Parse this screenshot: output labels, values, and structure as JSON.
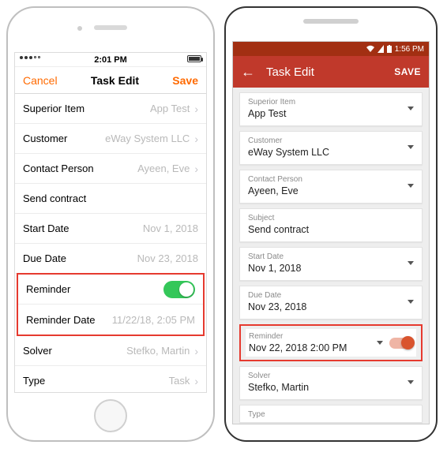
{
  "ios": {
    "statusTime": "2:01 PM",
    "nav": {
      "cancel": "Cancel",
      "title": "Task Edit",
      "save": "Save"
    },
    "rows": {
      "superior": {
        "label": "Superior Item",
        "value": "App Test"
      },
      "customer": {
        "label": "Customer",
        "value": "eWay System LLC"
      },
      "contact": {
        "label": "Contact Person",
        "value": "Ayeen,  Eve"
      },
      "subject": {
        "label": "Send contract"
      },
      "start": {
        "label": "Start Date",
        "value": "Nov 1, 2018"
      },
      "due": {
        "label": "Due Date",
        "value": "Nov 23, 2018"
      },
      "reminder": {
        "label": "Reminder"
      },
      "remdate": {
        "label": "Reminder Date",
        "value": "11/22/18, 2:05 PM"
      },
      "solver": {
        "label": "Solver",
        "value": "Stefko, Martin"
      },
      "type": {
        "label": "Type",
        "value": "Task"
      }
    }
  },
  "android": {
    "statusTime": "1:56 PM",
    "appbar": {
      "title": "Task Edit",
      "save": "SAVE"
    },
    "cards": {
      "superior": {
        "label": "Superior Item",
        "value": "App Test"
      },
      "customer": {
        "label": "Customer",
        "value": "eWay System LLC"
      },
      "contact": {
        "label": "Contact Person",
        "value": "Ayeen,  Eve"
      },
      "subject": {
        "label": "Subject",
        "value": "Send contract"
      },
      "start": {
        "label": "Start Date",
        "value": "Nov 1, 2018"
      },
      "due": {
        "label": "Due Date",
        "value": "Nov 23, 2018"
      },
      "reminder": {
        "label": "Reminder",
        "value": "Nov 22, 2018  2:00 PM"
      },
      "solver": {
        "label": "Solver",
        "value": "Stefko, Martin"
      },
      "type": {
        "label": "Type"
      }
    }
  }
}
